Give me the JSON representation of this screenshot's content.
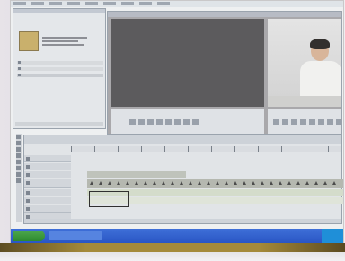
{
  "menubar": {
    "items": [
      "",
      "",
      "",
      "",
      "",
      "",
      "",
      "",
      ""
    ]
  },
  "project": {
    "title": "",
    "rows": [
      "",
      "",
      ""
    ]
  },
  "monitor": {
    "source_tab": "",
    "source_timecode": "",
    "program_timecode": ""
  },
  "timeline": {
    "sequence_tab": "",
    "tracks": [
      {
        "name": ""
      },
      {
        "name": ""
      },
      {
        "name": ""
      },
      {
        "name": ""
      },
      {
        "name": ""
      },
      {
        "name": ""
      },
      {
        "name": ""
      },
      {
        "name": ""
      }
    ]
  },
  "colors": {
    "taskbar": "#2f5fcc",
    "start_button": "#3c9a3c",
    "playhead": "#c03a2b",
    "clip_video": "#b5b8b0",
    "clip_audio": "#c9d6b8",
    "timecode": "#1e4f9c"
  },
  "icons": {
    "project_thumbnail": "film-clip-thumbnail",
    "tools": [
      "selection-tool-icon",
      "razor-tool-icon",
      "hand-tool-icon",
      "zoom-tool-icon"
    ],
    "keyframe": "keyframe-triangle-icon"
  }
}
